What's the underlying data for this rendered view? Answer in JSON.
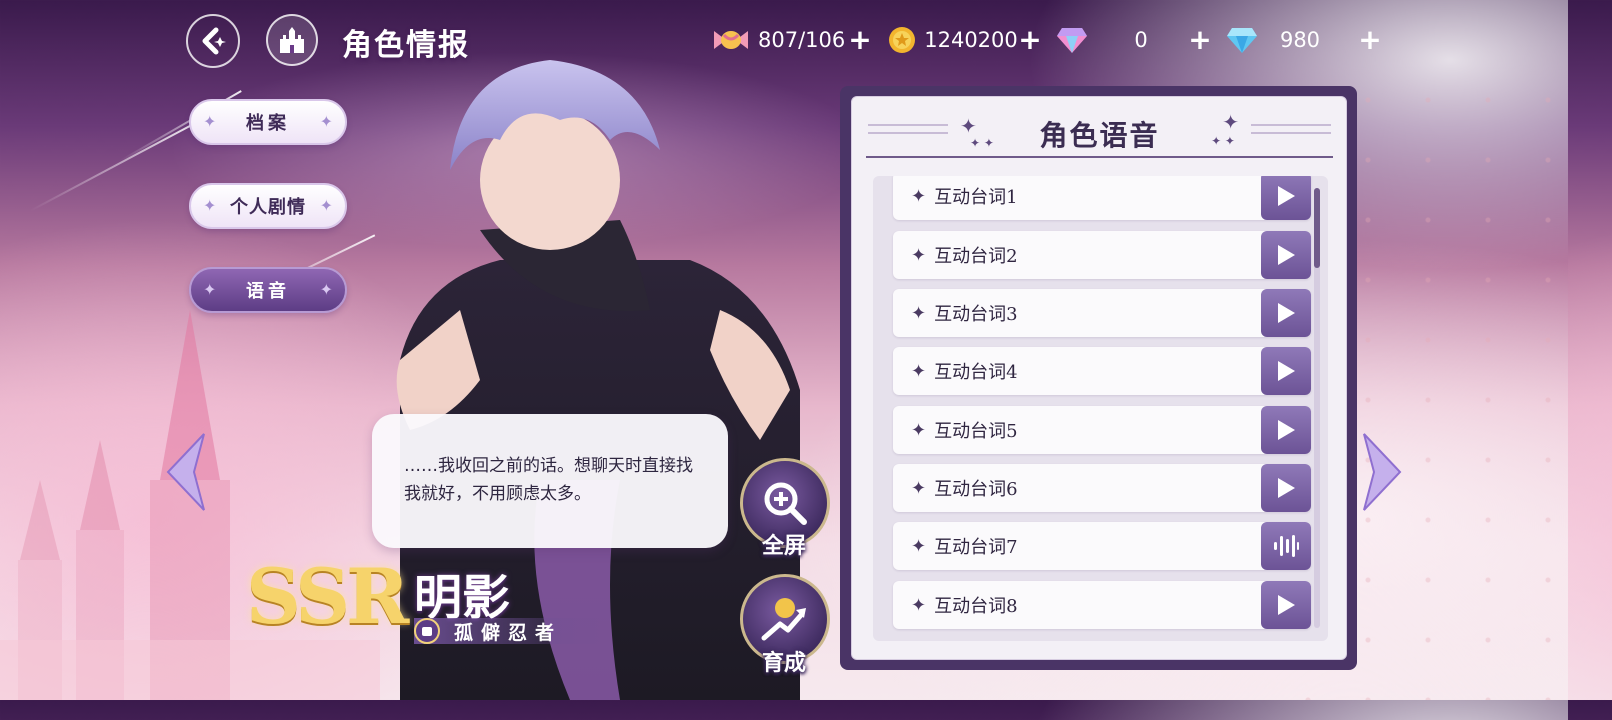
{
  "header": {
    "title": "角色情报",
    "resources": [
      {
        "icon": "candy-icon",
        "value": "807/106"
      },
      {
        "icon": "gold-coin-icon",
        "value": "1240200"
      },
      {
        "icon": "pink-diamond-icon",
        "value": "0"
      },
      {
        "icon": "blue-diamond-icon",
        "value": "980"
      }
    ]
  },
  "nav": {
    "items": [
      {
        "label": "档案",
        "active": false
      },
      {
        "label": "个人剧情",
        "active": false
      },
      {
        "label": "语音",
        "active": true
      }
    ]
  },
  "bubble": {
    "text": "……我收回之前的话。想聊天时直接找我就好，不用顾虑太多。"
  },
  "actions": {
    "fullscreen_label": "全屏",
    "develop_label": "育成"
  },
  "character": {
    "rarity": "SSR",
    "name": "明影",
    "title": "孤僻忍者"
  },
  "voice_panel": {
    "title": "角色语音",
    "items": [
      {
        "label": "互动台词1",
        "state": "play"
      },
      {
        "label": "互动台词2",
        "state": "play"
      },
      {
        "label": "互动台词3",
        "state": "play"
      },
      {
        "label": "互动台词4",
        "state": "play"
      },
      {
        "label": "互动台词5",
        "state": "play"
      },
      {
        "label": "互动台词6",
        "state": "play"
      },
      {
        "label": "互动台词7",
        "state": "playing"
      },
      {
        "label": "互动台词8",
        "state": "play"
      }
    ]
  },
  "colors": {
    "accent": "#6c5396",
    "panel_frame": "#4a3466",
    "gold": "#f6d36b"
  }
}
